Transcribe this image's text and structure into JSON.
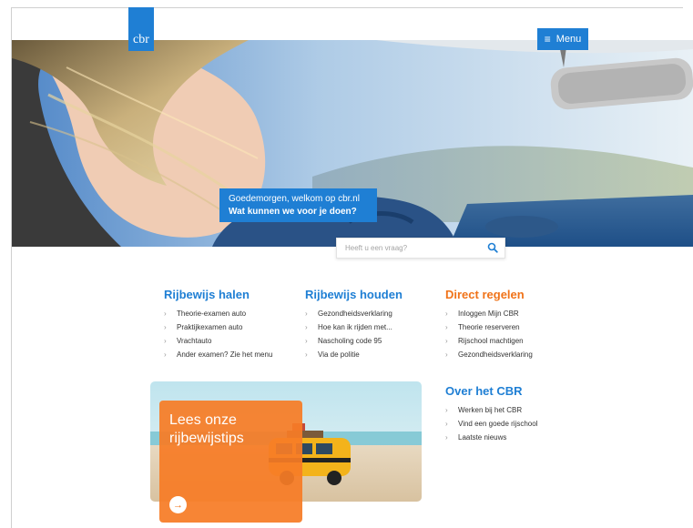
{
  "header": {
    "logo_text": "cbr",
    "menu_label": "Menu",
    "menu_icon": "hamburger-icon"
  },
  "hero": {
    "welcome_line1": "Goedemorgen, welkom op cbr.nl",
    "welcome_line2": "Wat kunnen we voor je doen?",
    "search_placeholder": "Heeft u een vraag?",
    "search_icon": "search-icon"
  },
  "columns": {
    "rijbewijs_halen": {
      "title": "Rijbewijs halen",
      "items": [
        "Theorie-examen auto",
        "Praktijkexamen auto",
        "Vrachtauto",
        "Ander examen? Zie het menu"
      ]
    },
    "rijbewijs_houden": {
      "title": "Rijbewijs houden",
      "items": [
        "Gezondheidsverklaring",
        "Hoe kan ik rijden met...",
        "Nascholing code 95",
        "Via de politie"
      ]
    },
    "direct_regelen": {
      "title": "Direct regelen",
      "items": [
        "Inloggen Mijn CBR",
        "Theorie reserveren",
        "Rijschool machtigen",
        "Gezondheidsverklaring"
      ]
    },
    "over_het_cbr": {
      "title": "Over het CBR",
      "items": [
        "Werken bij het CBR",
        "Vind een goede rijschool",
        "Laatste nieuws"
      ]
    }
  },
  "tips": {
    "line1": "Lees onze",
    "line2": "rijbewijstips",
    "arrow": "→"
  },
  "colors": {
    "brand_blue": "#1f7fd4",
    "accent_orange": "#f07319"
  }
}
